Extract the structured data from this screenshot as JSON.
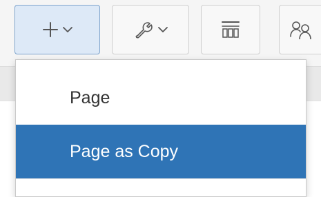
{
  "toolbar": {
    "buttons": [
      {
        "icon": "plus-icon",
        "has_caret": true,
        "state": "active"
      },
      {
        "icon": "wrench-icon",
        "has_caret": true,
        "state": "normal"
      },
      {
        "icon": "layout-icon",
        "has_caret": false,
        "state": "normal"
      },
      {
        "icon": "people-icon",
        "has_caret": false,
        "state": "normal"
      }
    ]
  },
  "create_menu": {
    "items": [
      {
        "label": "Page",
        "state": "normal"
      },
      {
        "label": "Page as Copy",
        "state": "highlighted"
      }
    ],
    "highlight_color": "#2f74b6"
  },
  "colors": {
    "active_button": "#dde9f7",
    "icon_stroke": "#555555"
  }
}
